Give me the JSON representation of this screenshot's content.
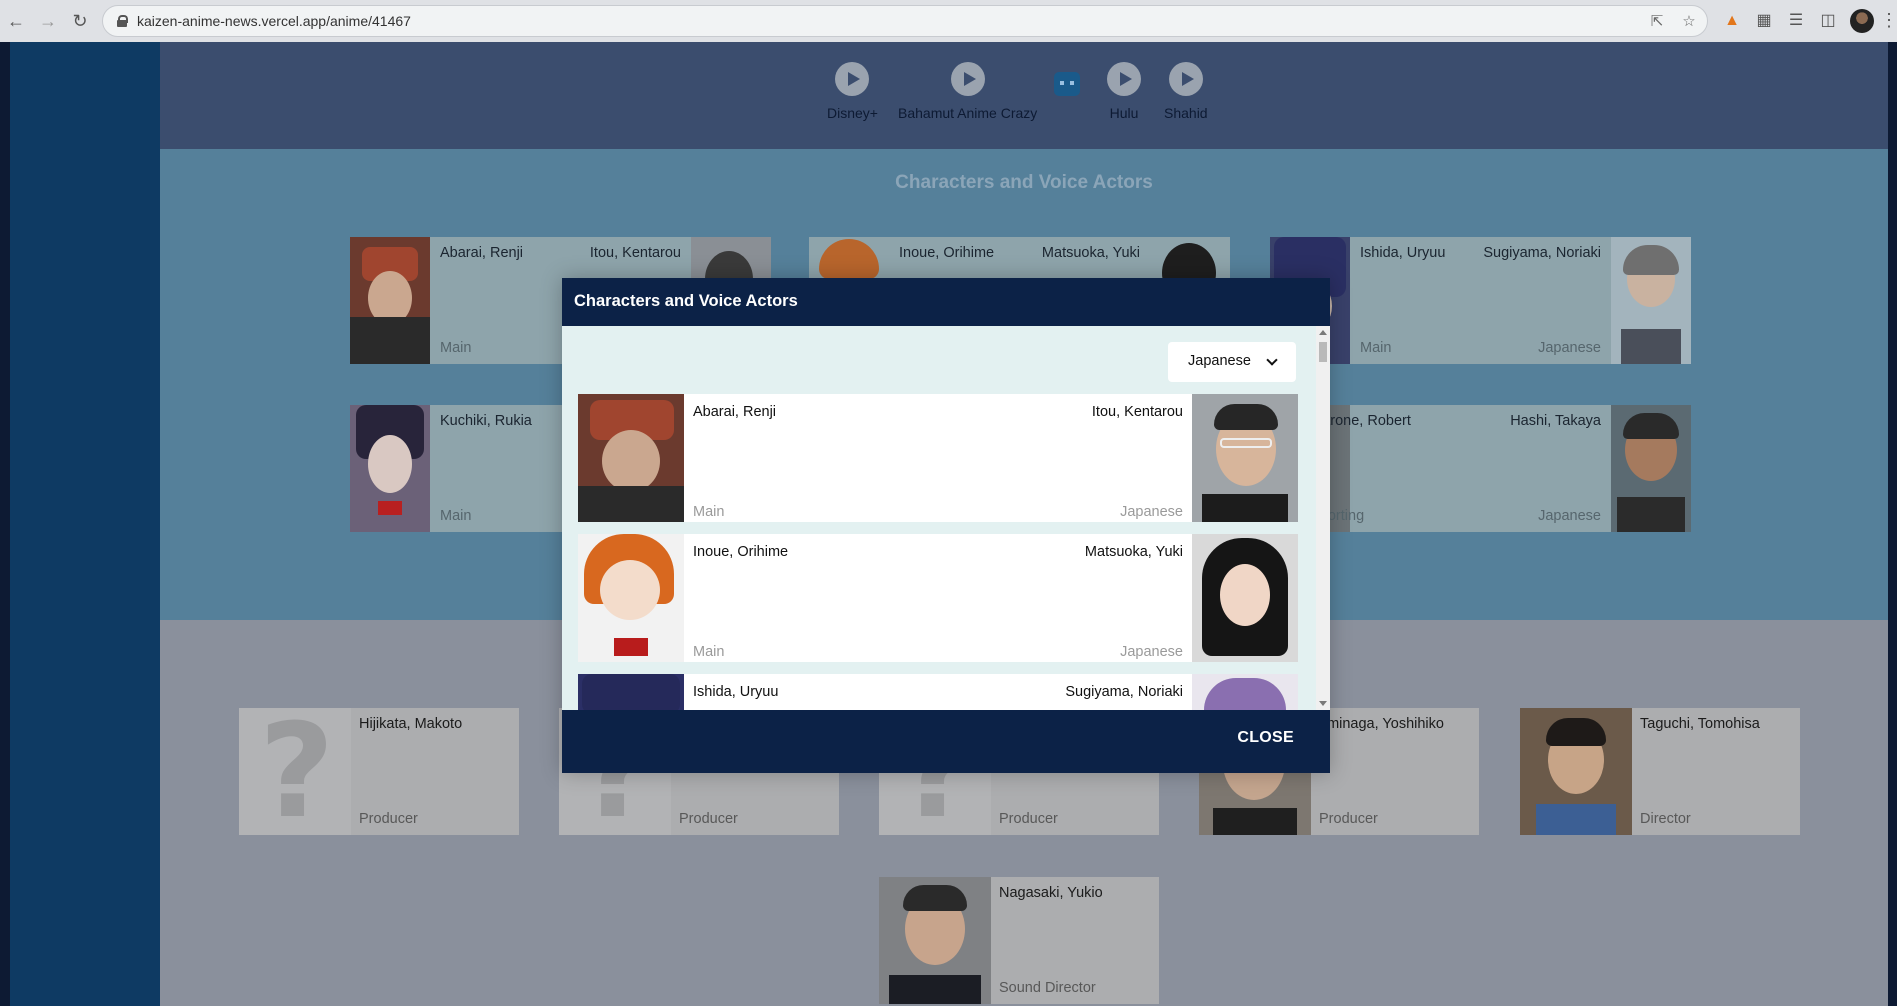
{
  "browser": {
    "url": "kaizen-anime-news.vercel.app/anime/41467",
    "icons": [
      "back-icon",
      "forward-icon",
      "reload-icon",
      "lock-icon",
      "share-icon",
      "star-icon",
      "metamask-icon",
      "puzzle-icon",
      "media-icon",
      "sidepanel-icon",
      "avatar",
      "kebab-icon"
    ]
  },
  "streaming": [
    {
      "label": "Disney+",
      "icon": "play-icon"
    },
    {
      "label": "Bahamut Anime Crazy",
      "icon": "play-icon"
    },
    {
      "label": "",
      "icon": "tv-icon"
    },
    {
      "label": "Hulu",
      "icon": "play-icon"
    },
    {
      "label": "Shahid",
      "icon": "play-icon"
    }
  ],
  "characters_section": {
    "title": "Characters and Voice Actors",
    "cards": [
      {
        "character": "Abarai, Renji",
        "role": "Main",
        "actor": "Itou, Kentarou",
        "language": ""
      },
      {
        "character": "Inoue, Orihime",
        "role": "",
        "actor": "Matsuoka, Yuki",
        "language": ""
      },
      {
        "character": "Ishida, Uryuu",
        "role": "Main",
        "actor": "Sugiyama, Noriaki",
        "language": "Japanese"
      },
      {
        "character": "Kuchiki, Rukia",
        "role": "Main",
        "actor": "",
        "language": ""
      },
      {
        "character": "Accutrone, Robert",
        "role": "Supporting",
        "actor": "Hashi, Takaya",
        "language": "Japanese"
      }
    ]
  },
  "staff": [
    {
      "name": "Hijikata, Makoto",
      "role": "Producer"
    },
    {
      "name": "",
      "role": "Producer"
    },
    {
      "name": "",
      "role": "Producer"
    },
    {
      "name": "ominaga, Yoshihiko",
      "role": "Producer"
    },
    {
      "name": "Taguchi, Tomohisa",
      "role": "Director"
    },
    {
      "name": "Nagasaki, Yukio",
      "role": "Sound Director"
    }
  ],
  "modal": {
    "title": "Characters and Voice Actors",
    "language_select": "Japanese",
    "rows": [
      {
        "character": "Abarai, Renji",
        "role": "Main",
        "actor": "Itou, Kentarou",
        "language": "Japanese"
      },
      {
        "character": "Inoue, Orihime",
        "role": "Main",
        "actor": "Matsuoka, Yuki",
        "language": "Japanese"
      },
      {
        "character": "Ishida, Uryuu",
        "role": "",
        "actor": "Sugiyama, Noriaki",
        "language": ""
      }
    ],
    "close_label": "CLOSE"
  },
  "colors": {
    "modal_header": "#0c2247",
    "modal_body": "#e3f1f1",
    "sidebar": "#0e3a63"
  }
}
